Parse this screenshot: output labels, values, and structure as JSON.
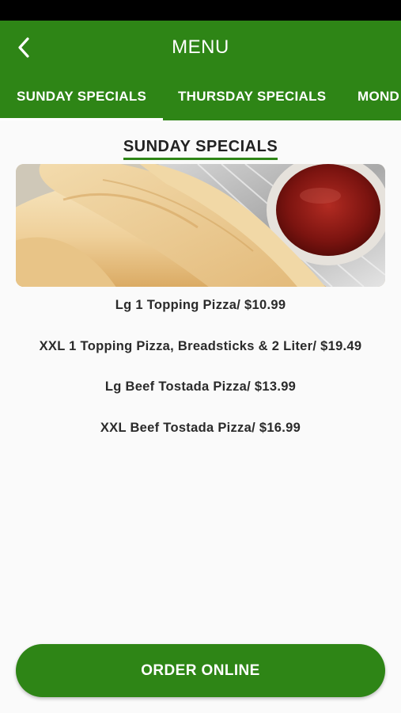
{
  "header": {
    "title": "MENU",
    "back_icon": "chevron-left-icon",
    "background_color": "#2e8516"
  },
  "tabs": [
    {
      "label": "SUNDAY SPECIALS",
      "active": true
    },
    {
      "label": "THURSDAY SPECIALS",
      "active": false
    },
    {
      "label": "MOND",
      "active": false
    }
  ],
  "section": {
    "title": "SUNDAY SPECIALS",
    "image": "breadsticks-with-marinara-photo"
  },
  "specials": [
    "Lg 1 Topping Pizza/ $10.99",
    "XXL 1 Topping Pizza, Breadsticks & 2 Liter/ $19.49",
    "Lg Beef Tostada Pizza/ $13.99",
    "XXL Beef Tostada Pizza/ $16.99"
  ],
  "order_button": {
    "label": "ORDER ONLINE"
  }
}
